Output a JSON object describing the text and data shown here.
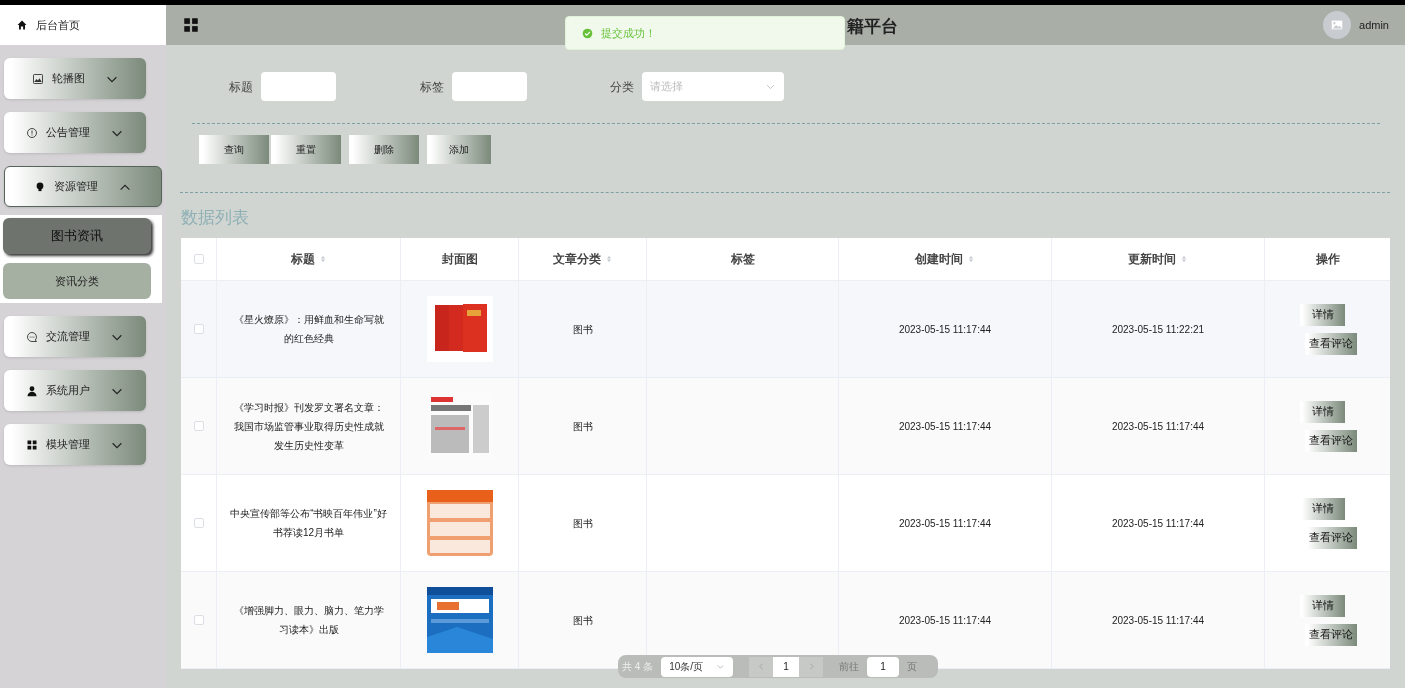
{
  "sidebar": {
    "home": {
      "label": "后台首页"
    },
    "menus": [
      {
        "label": "轮播图",
        "expanded": false
      },
      {
        "label": "公告管理",
        "expanded": false
      },
      {
        "label": "资源管理",
        "expanded": true,
        "children": [
          {
            "label": "图书资讯",
            "selected": true
          },
          {
            "label": "资讯分类",
            "selected": false
          }
        ]
      },
      {
        "label": "交流管理",
        "expanded": false
      },
      {
        "label": "系统用户",
        "expanded": false
      },
      {
        "label": "模块管理",
        "expanded": false
      }
    ]
  },
  "header": {
    "title": "籍平台",
    "user": "admin"
  },
  "toast": {
    "message": "提交成功！"
  },
  "search": {
    "fields": [
      {
        "label": "标题",
        "kind": "input"
      },
      {
        "label": "标签",
        "kind": "input"
      },
      {
        "label": "分类",
        "kind": "select",
        "placeholder": "请选择"
      }
    ],
    "buttons": [
      "查询",
      "重置",
      "删除",
      "添加"
    ]
  },
  "table": {
    "heading": "数据列表",
    "all_checked": false,
    "columns": [
      {
        "label": "标题",
        "sortable": true
      },
      {
        "label": "封面图",
        "sortable": false
      },
      {
        "label": "文章分类",
        "sortable": true
      },
      {
        "label": "标签",
        "sortable": false
      },
      {
        "label": "创建时间",
        "sortable": true
      },
      {
        "label": "更新时间",
        "sortable": true
      },
      {
        "label": "操作",
        "sortable": false
      }
    ],
    "rows": [
      {
        "checked": false,
        "title": "《星火燎原》：用鲜血和生命写就的红色经典",
        "cover": {
          "kind": "picture"
        },
        "category": "图书",
        "created": "2023-05-15 11:17:44",
        "updated": "2023-05-15 11:22:21",
        "actions": [
          "详情",
          "查看评论"
        ]
      },
      {
        "checked": false,
        "title": "《学习时报》刊发罗文署名文章：我国市场监管事业取得历史性成就发生历史性变革",
        "cover": {
          "kind": "picture"
        },
        "category": "图书",
        "created": "2023-05-15 11:17:44",
        "updated": "2023-05-15 11:17:44",
        "actions": [
          "详情",
          "查看评论"
        ]
      },
      {
        "checked": false,
        "title": "中央宣传部等公布“书映百年伟业”好书荐读12月书单",
        "cover": {
          "kind": "picture"
        },
        "category": "图书",
        "created": "2023-05-15 11:17:44",
        "updated": "2023-05-15 11:17:44",
        "actions": [
          "详情",
          "查看评论"
        ]
      },
      {
        "checked": false,
        "title": "《增强脚力、眼力、脑力、笔力学习读本》出版",
        "cover": {
          "kind": "picture"
        },
        "category": "图书",
        "created": "2023-05-15 11:17:44",
        "updated": "2023-05-15 11:17:44",
        "actions": [
          "详情",
          "查看评论"
        ]
      }
    ]
  },
  "pagination": {
    "total": "共 4 条",
    "page_size": "10条/页",
    "page": "1",
    "goto_label": "前往",
    "goto_value": "1",
    "page_unit": "页"
  }
}
